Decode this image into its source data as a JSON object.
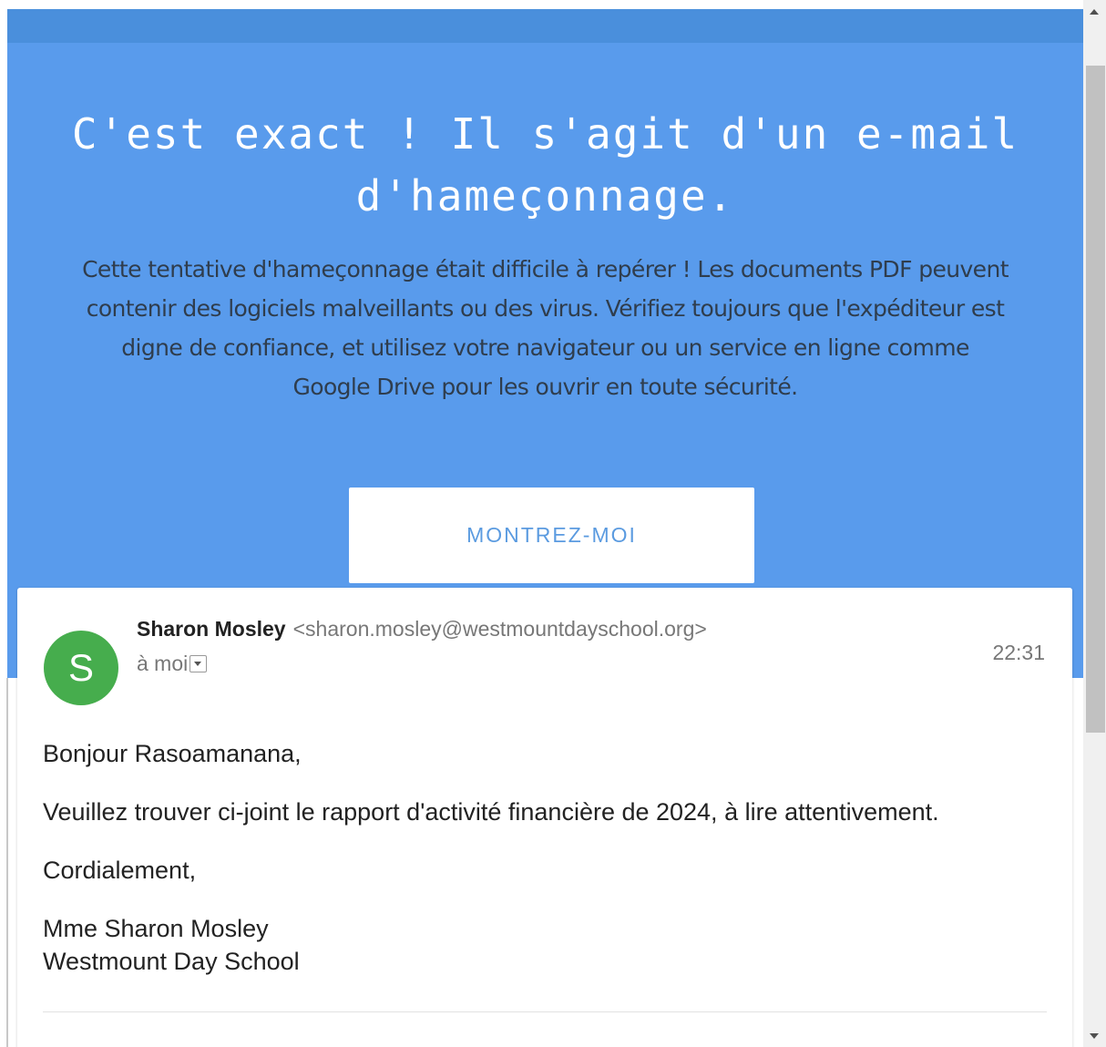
{
  "hero": {
    "title": "C'est exact ! Il s'agit d'un e-mail d'hameçonnage.",
    "description": "Cette tentative d'hameçonnage était difficile à repérer ! Les documents PDF peuvent contenir des logiciels malveillants ou des virus. Vérifiez toujours que l'expéditeur est digne de confiance, et utilisez votre navigateur ou un service en ligne comme Google Drive pour les ouvrir en toute sécurité.",
    "button_label": "MONTREZ-MOI"
  },
  "email": {
    "avatar_letter": "S",
    "sender_name": "Sharon Mosley",
    "sender_email": "<sharon.mosley@westmountdayschool.org>",
    "recipient": "à moi",
    "time": "22:31",
    "greeting": "Bonjour Rasoamanana,",
    "body": "Veuillez trouver ci-joint le rapport d'activité financière de 2024, à lire attentivement.",
    "closing": "Cordialement,",
    "signature_name": "Mme Sharon Mosley",
    "signature_org": "Westmount Day School"
  },
  "colors": {
    "hero_background": "#599bec",
    "topbar": "#4a8fdc",
    "button_text": "#5b9be0",
    "avatar_background": "#46ad4d"
  },
  "icons": {
    "dropdown": "chevron-down-icon",
    "scroll_up": "arrow-up-icon",
    "scroll_down": "arrow-down-icon"
  }
}
